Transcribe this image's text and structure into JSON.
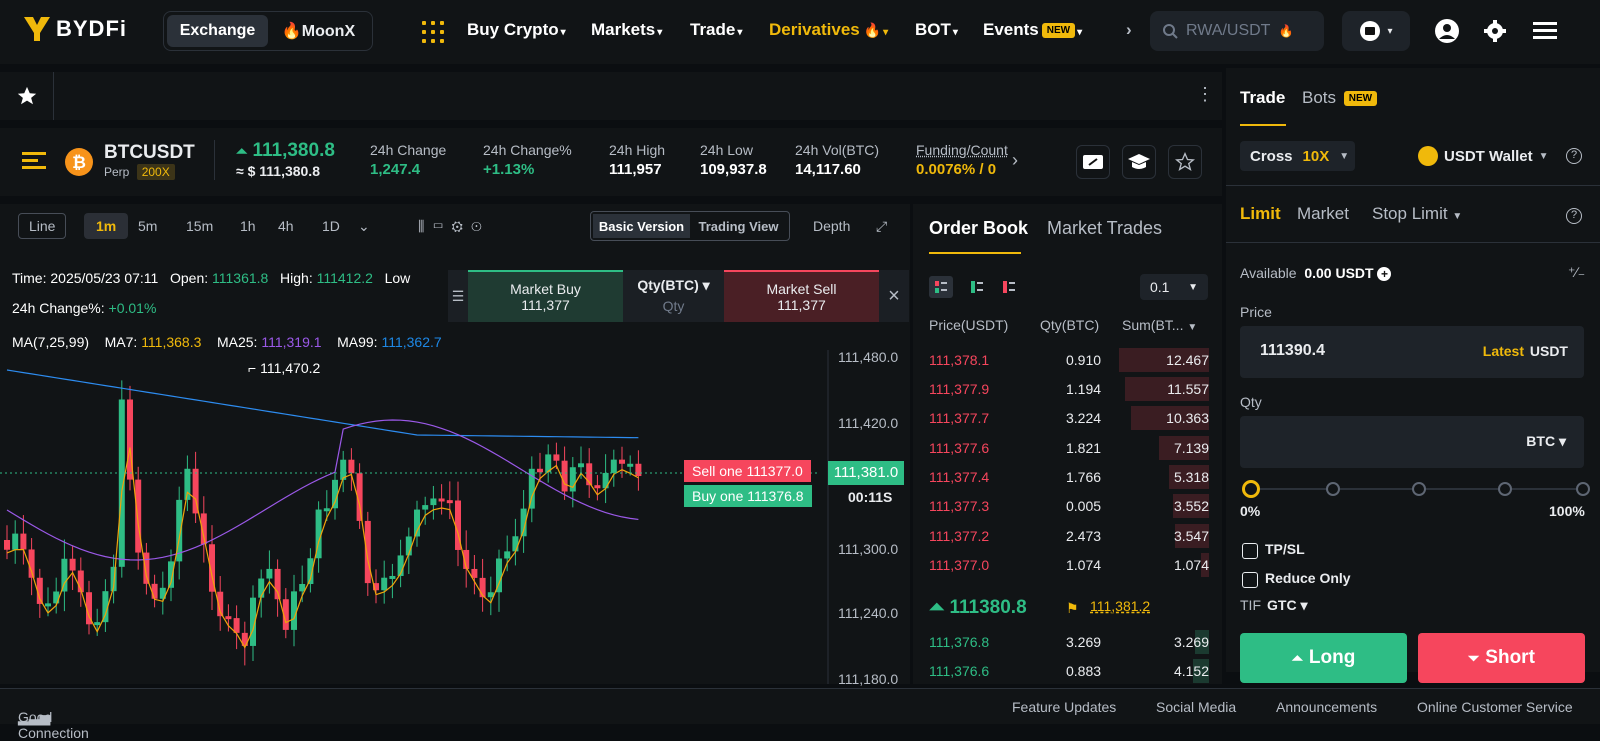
{
  "nav": {
    "logo": "BYDFi",
    "exchange_toggle": [
      "Exchange",
      "🔥MoonX"
    ],
    "menus": [
      "Buy Crypto",
      "Markets",
      "Trade",
      "Derivatives",
      "BOT",
      "Events"
    ],
    "events_badge": "NEW",
    "search_placeholder": "RWA/USDT"
  },
  "ticker": {
    "symbol": "BTCUSDT",
    "type": "Perp",
    "leverage": "200X",
    "last_price": "111,380.8",
    "last_price_usd": "≈ $ 111,380.8",
    "stats": [
      {
        "label": "24h Change",
        "value": "1,247.4"
      },
      {
        "label": "24h Change%",
        "value": "+1.13%"
      },
      {
        "label": "24h High",
        "value": "111,957"
      },
      {
        "label": "24h Low",
        "value": "109,937.8"
      },
      {
        "label": "24h Vol(BTC)",
        "value": "14,117.60"
      },
      {
        "label": "Funding/Count",
        "value": "0.0076% / 0"
      }
    ]
  },
  "chart_toolbar": {
    "line": "Line",
    "intervals": [
      "1m",
      "5m",
      "15m",
      "1h",
      "4h",
      "1D"
    ],
    "active_interval": "1m",
    "basic": "Basic Version",
    "tradingview": "Trading View",
    "depth": "Depth"
  },
  "chart_info": {
    "time": "Time: 2025/05/23 07:11",
    "open_label": "Open:",
    "open": "111361.8",
    "high_label": "High:",
    "high": "111412.2",
    "low_label": "Low",
    "change_label": "24h Change%:",
    "change": "+0.01%",
    "ma_label": "MA(7,25,99)",
    "ma7": "MA7: ",
    "ma7_v": "111,368.3",
    "ma25": "MA25: ",
    "ma25_v": "111,319.1",
    "ma99": "MA99: ",
    "ma99_v": "111,362.7"
  },
  "quick": {
    "buy_label": "Market Buy",
    "buy_price": "111,377",
    "qty_label": "Qty(BTC)",
    "qty_sub": "Qty",
    "sell_label": "Market Sell",
    "sell_price": "111,377"
  },
  "chart": {
    "high_marker": "111,470.2",
    "y_ticks": [
      "111,480.0",
      "111,420.0",
      "111,300.0",
      "111,240.0",
      "111,180.0"
    ],
    "sell_one": "Sell one 111377.0",
    "buy_one": "Buy one 111376.8",
    "current": "111,381.0",
    "countdown": "00:11S"
  },
  "orderbook": {
    "tabs": [
      "Order Book",
      "Market Trades"
    ],
    "precision": "0.1",
    "headers": [
      "Price(USDT)",
      "Qty(BTC)",
      "Sum(BT..."
    ],
    "asks": [
      [
        "111,378.1",
        "0.910",
        "12.467"
      ],
      [
        "111,377.9",
        "1.194",
        "11.557"
      ],
      [
        "111,377.7",
        "3.224",
        "10.363"
      ],
      [
        "111,377.6",
        "1.821",
        "7.139"
      ],
      [
        "111,377.4",
        "1.766",
        "5.318"
      ],
      [
        "111,377.3",
        "0.005",
        "3.552"
      ],
      [
        "111,377.2",
        "2.473",
        "3.547"
      ],
      [
        "111,377.0",
        "1.074",
        "1.074"
      ]
    ],
    "mid_price": "111380.8",
    "mark_price": "111,381.2",
    "bids": [
      [
        "111,376.8",
        "3.269",
        "3.269"
      ],
      [
        "111,376.6",
        "0.883",
        "4.152"
      ]
    ]
  },
  "trade": {
    "tabs": [
      "Trade",
      "Bots"
    ],
    "bots_badge": "NEW",
    "margin": "Cross",
    "lev": "10X",
    "wallet": "USDT Wallet",
    "order_types": [
      "Limit",
      "Market",
      "Stop Limit"
    ],
    "available_label": "Available",
    "available": "0.00 USDT",
    "price_label": "Price",
    "price": "111390.4",
    "latest": "Latest",
    "unit": "USDT",
    "qty_label": "Qty",
    "qty_unit": "BTC",
    "slider_min": "0%",
    "slider_max": "100%",
    "tpsl": "TP/SL",
    "reduce": "Reduce Only",
    "tif": "TIF",
    "gtc": "GTC",
    "long": "Long",
    "short": "Short"
  },
  "footer": {
    "connection": "Good Connection",
    "links": [
      "Feature Updates",
      "Social Media",
      "Announcements",
      "Online Customer Service"
    ]
  },
  "colors": {
    "accent": "#f0b90b",
    "up": "#2ebd85",
    "down": "#f6465d"
  }
}
